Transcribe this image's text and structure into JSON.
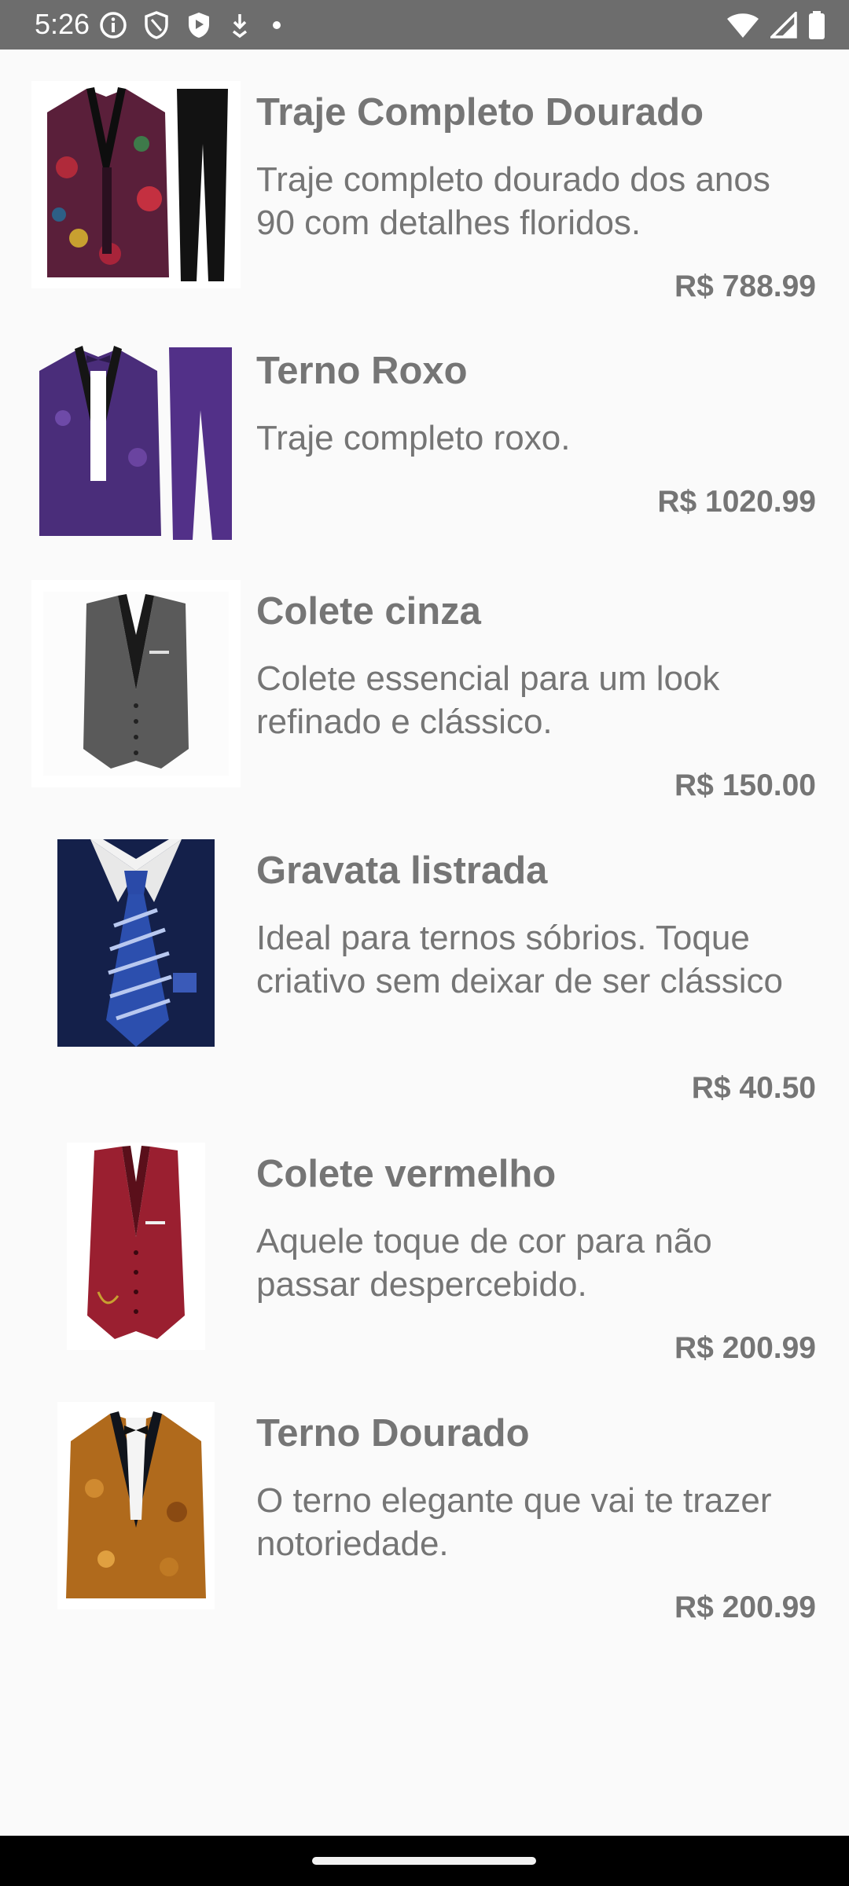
{
  "status_bar": {
    "time": "5:26",
    "left_icons": [
      "info-icon",
      "shield-icon",
      "shield-filled-icon",
      "download-arrow-icon",
      "dot-icon"
    ],
    "right_icons": [
      "wifi-icon",
      "signal-icon",
      "battery-icon"
    ]
  },
  "products": [
    {
      "name": "Traje Completo Dourado",
      "description": "Traje completo dourado dos anos 90 com detalhes floridos.",
      "price": "R$ 788.99",
      "image": "floral-suit-image"
    },
    {
      "name": "Terno Roxo",
      "description": "Traje completo roxo.",
      "price": "R$ 1020.99",
      "image": "purple-suit-image"
    },
    {
      "name": "Colete cinza",
      "description": "Colete essencial para um look refinado e clássico.",
      "price": "R$ 150.00",
      "image": "gray-vest-image"
    },
    {
      "name": "Gravata listrada",
      "description": "Ideal para ternos sóbrios. Toque criativo sem deixar de ser clássico",
      "price": "R$ 40.50",
      "image": "striped-tie-image"
    },
    {
      "name": "Colete vermelho",
      "description": "Aquele toque de cor para não passar despercebido.",
      "price": "R$ 200.99",
      "image": "red-vest-image"
    },
    {
      "name": "Terno Dourado",
      "description": "O terno elegante que vai te trazer notoriedade.",
      "price": "R$ 200.99",
      "image": "gold-blazer-image"
    }
  ],
  "colors": {
    "status_bar": "#6d6d6d",
    "background": "#fafafa",
    "text": "#757575",
    "nav_bar": "#000000"
  }
}
